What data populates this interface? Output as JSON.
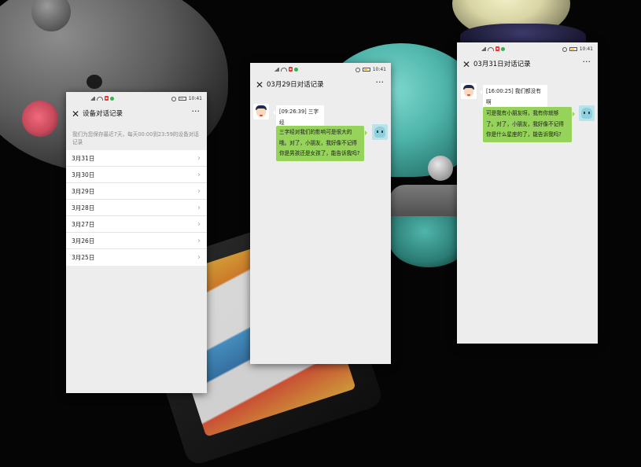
{
  "list_screen": {
    "status_time": "10:41",
    "title": "设备对话记录",
    "notice": "我们为您保存最近7天，每天00:00到23:59的设备对话记录",
    "dates": [
      "3月31日",
      "3月30日",
      "3月29日",
      "3月28日",
      "3月27日",
      "3月26日",
      "3月25日"
    ]
  },
  "chat_screen_1": {
    "status_time": "10:41",
    "title": "03月29日对话记录",
    "user_message": "[09:26:39] 三字经",
    "bot_message": "三字经对我们的影响可是很大的哦。对了，小朋友，我好像不记得你是男孩还是女孩了，能告诉我吗?"
  },
  "chat_screen_2": {
    "status_time": "10:41",
    "title": "03月31日对话记录",
    "user_message": "[16:00:25] 我们都没有啊",
    "bot_message": "可是我有小朋友呀，我有你就够了。对了，小朋友，我好像不记得你是什么星座的了，能告诉我吗?"
  },
  "icons": {
    "close": "close-icon",
    "more": "more-icon",
    "chevron": "chevron-right-icon"
  },
  "colors": {
    "bot_bubble": "#95d35a",
    "user_bubble": "#ffffff",
    "screen_bg": "#ededed"
  }
}
